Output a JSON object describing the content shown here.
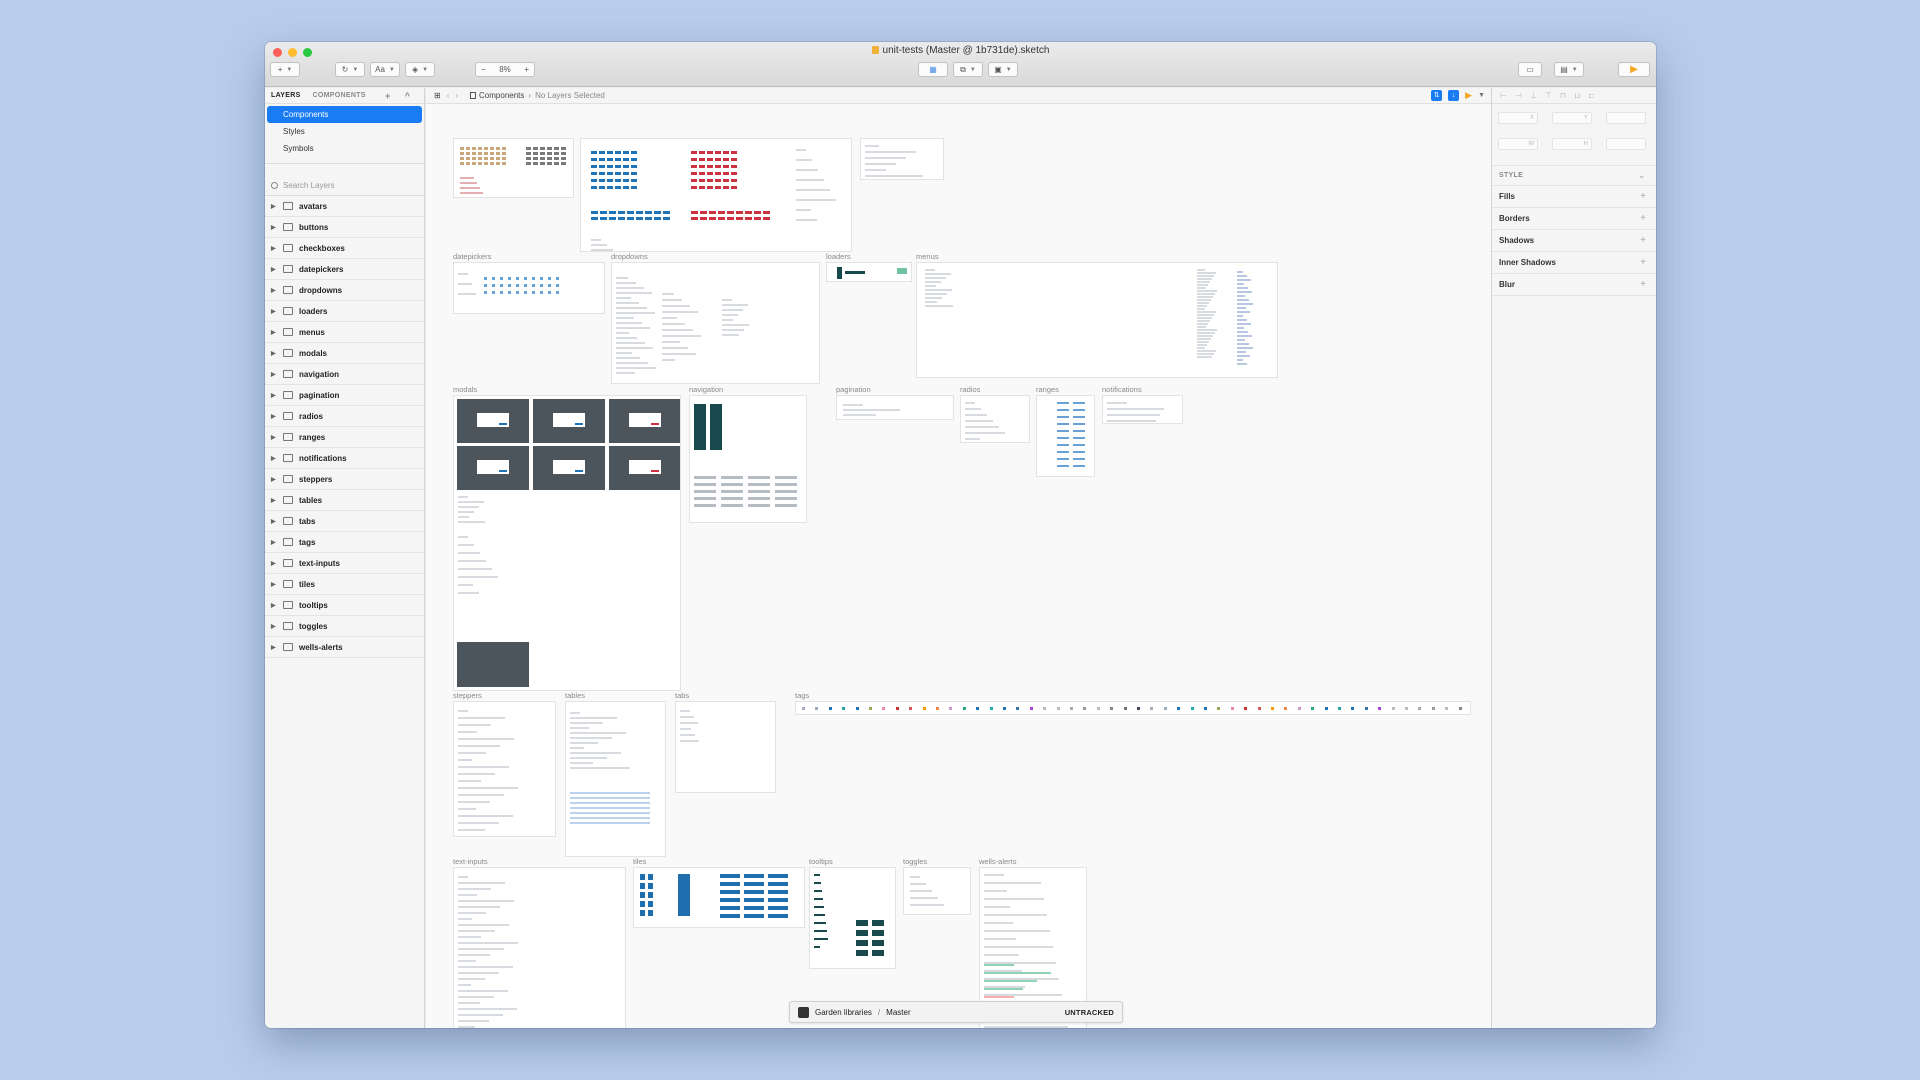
{
  "window": {
    "title": "unit-tests (Master @ 1b731de).sketch",
    "traffic_lights": [
      "#ff5f57",
      "#febc2e",
      "#28c840"
    ]
  },
  "toolbar": {
    "insert": "+",
    "font": "Aa",
    "zoom": "8%",
    "zoom_out": "−",
    "zoom_in": "+"
  },
  "left_panel": {
    "tabs": [
      "LAYERS",
      "COMPONENTS"
    ],
    "pages": [
      "Components",
      "Styles",
      "Symbols"
    ],
    "search_placeholder": "Search Layers",
    "layers": [
      "avatars",
      "buttons",
      "checkboxes",
      "datepickers",
      "dropdowns",
      "loaders",
      "menus",
      "modals",
      "navigation",
      "pagination",
      "radios",
      "ranges",
      "notifications",
      "steppers",
      "tables",
      "tabs",
      "tags",
      "text-inputs",
      "tiles",
      "tooltips",
      "toggles",
      "wells-alerts"
    ]
  },
  "canvas_bar": {
    "page": "Components",
    "selection": "No Layers Selected"
  },
  "artboards": {
    "datepickers": "datepickers",
    "dropdowns": "dropdowns",
    "loaders": "loaders",
    "menus": "menus",
    "modals": "modals",
    "navigation": "navigation",
    "pagination": "pagination",
    "radios": "radios",
    "ranges": "ranges",
    "notifications": "notifications",
    "steppers": "steppers",
    "tables": "tables",
    "tabs": "tabs",
    "tags": "tags",
    "text_inputs": "text-inputs",
    "tiles": "tiles",
    "tooltips": "tooltips",
    "toggles": "toggles",
    "wells_alerts": "wells-alerts"
  },
  "library_bar": {
    "library": "Garden libraries",
    "separator": "/",
    "branch": "Master",
    "status": "UNTRACKED"
  },
  "inspector": {
    "style_header": "STYLE",
    "sections": [
      "Fills",
      "Borders",
      "Shadows",
      "Inner Shadows",
      "Blur"
    ],
    "field_hints": [
      "X",
      "Y",
      "",
      "W",
      "H",
      ""
    ]
  },
  "colors": {
    "accent": "#1a7cf5",
    "modal_dark": "#4c545c",
    "nav_dark": "#17494d",
    "chart_blue": "#1f73b7",
    "chart_red": "#cc3340",
    "tile_blue": "#1f6fae"
  }
}
